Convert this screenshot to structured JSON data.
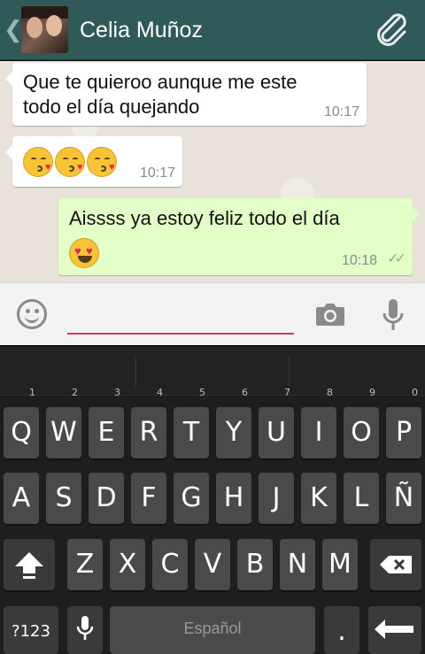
{
  "header": {
    "contact_name": "Celia Muñoz",
    "back_icon": "chevron-left-icon",
    "attach_icon": "paperclip-icon",
    "background_color": "#2f5a57"
  },
  "messages": [
    {
      "direction": "incoming",
      "text_line1": "Que te quieroo aunque me este",
      "text_line2": "todo el día quejando",
      "time": "10:17"
    },
    {
      "direction": "incoming",
      "emoji": [
        "kissing-heart-emoji",
        "kissing-heart-emoji",
        "kissing-heart-emoji"
      ],
      "time": "10:17"
    },
    {
      "direction": "outgoing",
      "text": "Aissss ya estoy feliz todo el día",
      "emoji": [
        "heart-eyes-emoji"
      ],
      "time": "10:18",
      "status": "read"
    }
  ],
  "input_bar": {
    "emoji_icon": "smiley-icon",
    "camera_icon": "camera-icon",
    "mic_icon": "microphone-icon",
    "placeholder": "",
    "underline_color": "#c83c6b"
  },
  "keyboard": {
    "row1": [
      {
        "label": "Q",
        "hint": "1"
      },
      {
        "label": "W",
        "hint": "2"
      },
      {
        "label": "E",
        "hint": "3"
      },
      {
        "label": "R",
        "hint": "4"
      },
      {
        "label": "T",
        "hint": "5"
      },
      {
        "label": "Y",
        "hint": "6"
      },
      {
        "label": "U",
        "hint": "7"
      },
      {
        "label": "I",
        "hint": "8"
      },
      {
        "label": "O",
        "hint": "9"
      },
      {
        "label": "P",
        "hint": "0"
      }
    ],
    "row2": [
      "A",
      "S",
      "D",
      "F",
      "G",
      "H",
      "J",
      "K",
      "L",
      "Ñ"
    ],
    "row3": [
      "Z",
      "X",
      "C",
      "V",
      "B",
      "N",
      "M"
    ],
    "symbols_label": "?123",
    "space_label": "Español",
    "period_label": ".",
    "shift_icon": "shift-icon",
    "backspace_icon": "backspace-icon",
    "enter_icon": "enter-icon"
  }
}
